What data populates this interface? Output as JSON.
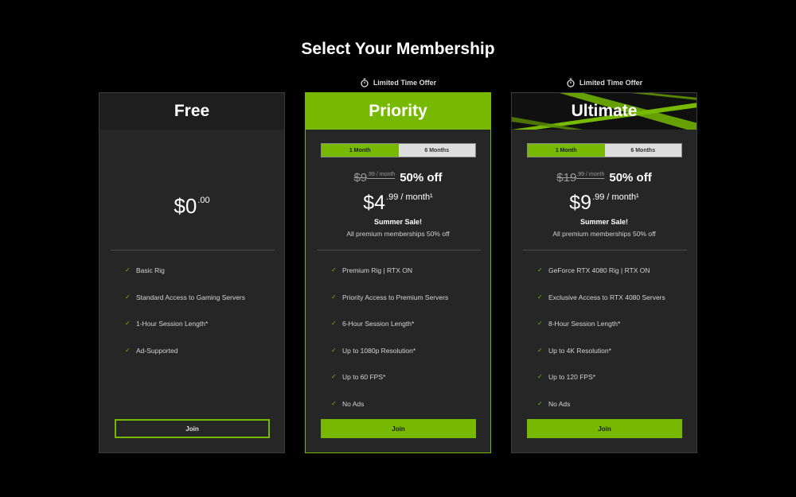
{
  "page": {
    "title": "Select Your Membership"
  },
  "colors": {
    "accent": "#76b900",
    "background": "#000000",
    "card": "#262626"
  },
  "plans": {
    "free": {
      "name": "Free",
      "price_main": "$0",
      "price_cents": ".00",
      "features": [
        "Basic Rig",
        "Standard Access to Gaming Servers",
        "1-Hour Session Length*",
        "Ad-Supported"
      ],
      "join_label": "Join"
    },
    "priority": {
      "offer": "Limited Time Offer",
      "name": "Priority",
      "tabs": [
        "1 Month",
        "6 Months"
      ],
      "selected_tab": "1 Month",
      "original_price_main": "$9",
      "original_price_sup": ".99 / month",
      "discount": "50% off",
      "price_main": "$4",
      "price_cents": ".99",
      "price_per": "/ month¹",
      "sale_title": "Summer Sale!",
      "sale_subtitle": "All premium memberships 50% off",
      "features": [
        "Premium Rig | RTX ON",
        "Priority Access to Premium Servers",
        "6-Hour Session Length*",
        "Up to 1080p Resolution*",
        "Up to 60 FPS*",
        "No Ads"
      ],
      "join_label": "Join"
    },
    "ultimate": {
      "offer": "Limited Time Offer",
      "name": "Ultimate",
      "tabs": [
        "1 Month",
        "6 Months"
      ],
      "selected_tab": "1 Month",
      "original_price_main": "$19",
      "original_price_sup": ".99 / month",
      "discount": "50% off",
      "price_main": "$9",
      "price_cents": ".99",
      "price_per": "/ month¹",
      "sale_title": "Summer Sale!",
      "sale_subtitle": "All premium memberships 50% off",
      "features": [
        "GeForce RTX 4080 Rig | RTX ON",
        "Exclusive Access to RTX 4080 Servers",
        "8-Hour Session Length*",
        "Up to 4K Resolution*",
        "Up to 120 FPS*",
        "No Ads"
      ],
      "join_label": "Join"
    }
  },
  "icons": {
    "offer": "stopwatch-icon",
    "feature": "checkmark-icon"
  }
}
